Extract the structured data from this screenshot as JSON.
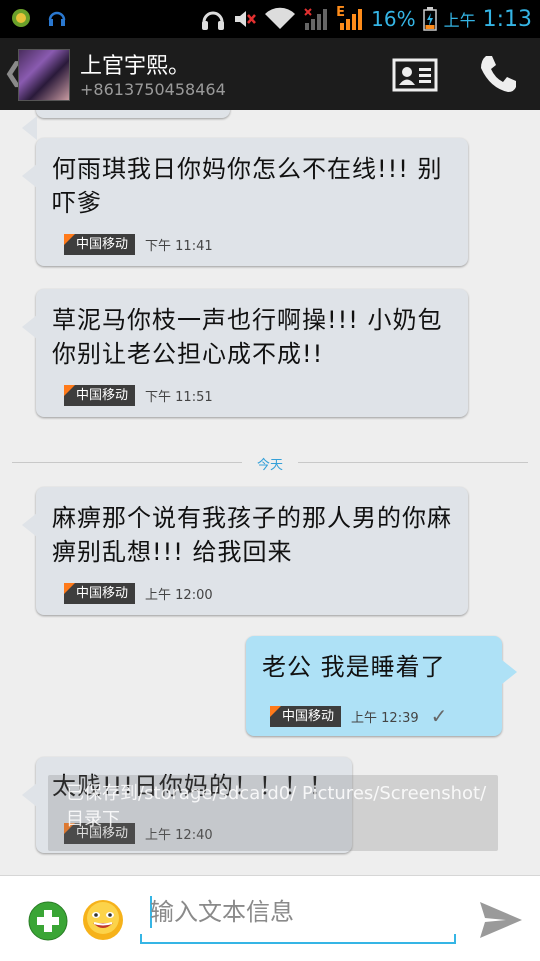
{
  "status_bar": {
    "battery_percent": "16%",
    "ampm": "上午",
    "time": "1:13",
    "network_label": "E"
  },
  "header": {
    "back_icon": "chevron-left-icon",
    "contact_name": "上官宇熙。",
    "contact_phone": "+8613750458464",
    "contact_card_icon": "contact-card-icon",
    "call_icon": "phone-icon"
  },
  "messages": [
    {
      "direction": "in",
      "text": " 何雨琪我日你妈你怎么不在线!!! 别吓爹",
      "carrier": "中国移动",
      "time": "下午 11:41"
    },
    {
      "direction": "in",
      "text": "草泥马你枝一声也行啊操!!!  小奶包你别让老公担心成不成!!",
      "carrier": "中国移动",
      "time": "下午 11:51"
    },
    {
      "direction": "in",
      "text": "麻痹那个说有我孩子的那人男的你麻痹别乱想!!!    给我回来",
      "carrier": "中国移动",
      "time": "上午 12:00"
    },
    {
      "direction": "out",
      "text": "老公 我是睡着了",
      "carrier": "中国移动",
      "time": "上午 12:39"
    },
    {
      "direction": "in",
      "text": "太贱!!!日你妈的！！！！",
      "carrier": "中国移动",
      "time": "上午 12:40"
    }
  ],
  "date_divider": "今天",
  "toast": "已保存到/storage/sdcard0/ Pictures/Screenshot/目录下",
  "compose": {
    "placeholder": "输入文本信息",
    "add_icon": "plus-circle-icon",
    "emoji_icon": "emoji-icon",
    "send_icon": "send-icon"
  },
  "colors": {
    "accent": "#35b5e5",
    "incoming_bubble": "#dfe3e8",
    "outgoing_bubble": "#aee1f6",
    "carrier_badge": "#3d3d3d",
    "carrier_mark": "#ff7a1a"
  }
}
